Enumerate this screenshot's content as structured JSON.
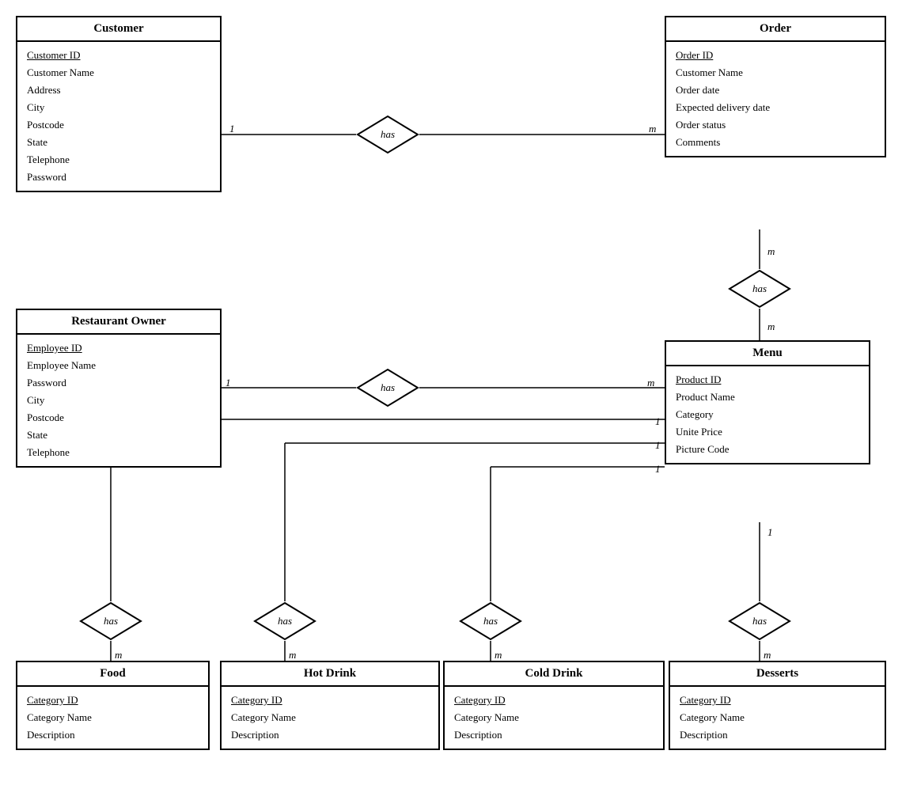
{
  "entities": {
    "customer": {
      "title": "Customer",
      "fields": [
        {
          "name": "Customer ID",
          "pk": true
        },
        {
          "name": "Customer Name",
          "pk": false
        },
        {
          "name": "Address",
          "pk": false
        },
        {
          "name": "City",
          "pk": false
        },
        {
          "name": "Postcode",
          "pk": false
        },
        {
          "name": "State",
          "pk": false
        },
        {
          "name": "Telephone",
          "pk": false
        },
        {
          "name": "Password",
          "pk": false
        }
      ]
    },
    "order": {
      "title": "Order",
      "fields": [
        {
          "name": "Order ID",
          "pk": true
        },
        {
          "name": "Customer Name",
          "pk": false
        },
        {
          "name": "Order date",
          "pk": false
        },
        {
          "name": "Expected delivery date",
          "pk": false
        },
        {
          "name": "Order status",
          "pk": false
        },
        {
          "name": "Comments",
          "pk": false
        }
      ]
    },
    "restaurantOwner": {
      "title": "Restaurant Owner",
      "fields": [
        {
          "name": "Employee ID",
          "pk": true
        },
        {
          "name": "Employee Name",
          "pk": false
        },
        {
          "name": "Password",
          "pk": false
        },
        {
          "name": "City",
          "pk": false
        },
        {
          "name": "Postcode",
          "pk": false
        },
        {
          "name": "State",
          "pk": false
        },
        {
          "name": "Telephone",
          "pk": false
        }
      ]
    },
    "menu": {
      "title": "Menu",
      "fields": [
        {
          "name": "Product ID",
          "pk": true
        },
        {
          "name": "Product Name",
          "pk": false
        },
        {
          "name": "Category",
          "pk": false
        },
        {
          "name": "Unite Price",
          "pk": false
        },
        {
          "name": "Picture Code",
          "pk": false
        }
      ]
    },
    "food": {
      "title": "Food",
      "fields": [
        {
          "name": "Category ID",
          "pk": true
        },
        {
          "name": "Category Name",
          "pk": false
        },
        {
          "name": "Description",
          "pk": false
        }
      ]
    },
    "hotDrink": {
      "title": "Hot Drink",
      "fields": [
        {
          "name": "Category ID",
          "pk": true
        },
        {
          "name": "Category Name",
          "pk": false
        },
        {
          "name": "Description",
          "pk": false
        }
      ]
    },
    "coldDrink": {
      "title": "Cold Drink",
      "fields": [
        {
          "name": "Category ID",
          "pk": true
        },
        {
          "name": "Category Name",
          "pk": false
        },
        {
          "name": "Description",
          "pk": false
        }
      ]
    },
    "desserts": {
      "title": "Desserts",
      "fields": [
        {
          "name": "Category ID",
          "pk": true
        },
        {
          "name": "Category Name",
          "pk": false
        },
        {
          "name": "Description",
          "pk": false
        }
      ]
    }
  },
  "diamonds": {
    "customerHas": {
      "label": "has"
    },
    "orderHas": {
      "label": "has"
    },
    "ownerHas": {
      "label": "has"
    },
    "foodHas": {
      "label": "has"
    },
    "hotHas": {
      "label": "has"
    },
    "coldHas": {
      "label": "has"
    },
    "dessertHas": {
      "label": "has"
    }
  },
  "cardinalities": {
    "c1": "1",
    "cm": "m",
    "o1": "m",
    "om": "m",
    "r1": "1",
    "rm": "m",
    "food_m": "m",
    "hot_m": "m",
    "cold_m": "m",
    "des_m": "m",
    "menu_food": "1",
    "menu_hot": "1",
    "menu_cold": "1",
    "menu_des": "1"
  }
}
